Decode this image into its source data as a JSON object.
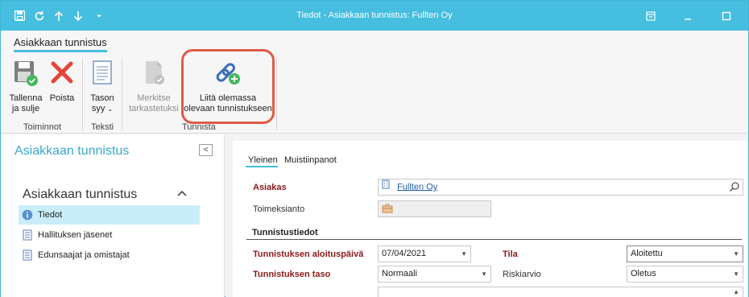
{
  "window": {
    "title": "Tiedot - Asiakkaan tunnistus: Fullten Oy"
  },
  "ribbon": {
    "tab_label": "Asiakkaan tunnistus",
    "buttons": {
      "save_close": {
        "line1": "Tallenna",
        "line2": "ja sulje",
        "icon": "save-check-icon"
      },
      "delete": {
        "line1": "Poista",
        "icon": "red-x-icon"
      },
      "level_reason": {
        "line1": "Tason",
        "line2": "syy",
        "icon": "document-lines-icon"
      },
      "mark_checked": {
        "line1": "Merkitse",
        "line2": "tarkastetuksi",
        "icon": "document-check-icon"
      },
      "attach_existing": {
        "line1": "Liitä olemassa",
        "line2": "olevaan tunnistukseen",
        "icon": "chain-link-add-icon"
      }
    },
    "groups": {
      "actions": "Toiminnot",
      "text": "Teksti",
      "identification": "Tunnista"
    }
  },
  "left_nav": {
    "title": "Asiakkaan tunnistus",
    "collapse_glyph": "<",
    "section_title": "Asiakkaan tunnistus",
    "items": [
      {
        "label": "Tiedot",
        "icon": "info-icon",
        "active": true
      },
      {
        "label": "Hallituksen jäsenet",
        "icon": "list-doc-icon",
        "active": false
      },
      {
        "label": "Edunsaajat ja omistajat",
        "icon": "list-doc-icon",
        "active": false
      }
    ]
  },
  "form": {
    "tabs": [
      "Yleinen",
      "Muistiinpanot"
    ],
    "customer_label": "Asiakas",
    "customer_value": "Fullten Oy",
    "assignment_label": "Toimeksianto",
    "section_title": "Tunnistustiedot",
    "start_date_label": "Tunnistuksen aloituspäivä",
    "start_date_value": "07/04/2021",
    "state_label": "Tila",
    "state_value": "Aloitettu",
    "level_label": "Tunnistuksen taso",
    "level_value": "Normaali",
    "risk_label": "Riskiarvio",
    "risk_value": "Oletus"
  },
  "colors": {
    "accent": "#45bedf",
    "required_label": "#8b1a1a",
    "highlight_border": "#e05a48",
    "active_nav": "#c9eef9"
  }
}
